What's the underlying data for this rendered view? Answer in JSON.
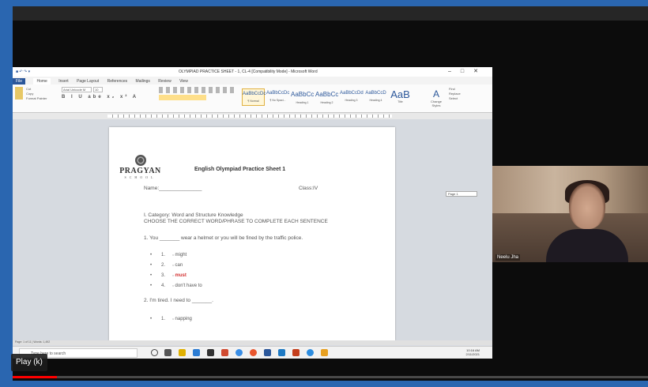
{
  "player": {
    "tooltip": "Play (k)",
    "progress_fraction": 0.07,
    "colors": {
      "progress": "#ff0000",
      "frame": "#2a66b0"
    }
  },
  "word": {
    "title": "OLYMPIAD PRACTICE SHEET - 1, CL-4 [Compatibility Mode] - Microsoft Word",
    "menu": [
      "File",
      "Home",
      "Insert",
      "Page Layout",
      "References",
      "Mailings",
      "Review",
      "View"
    ],
    "ribbon": {
      "font_name": "Arial Unicode M",
      "font_size": "10",
      "styles": [
        {
          "sample": "AaBbCcDc",
          "name": "¶ Normal"
        },
        {
          "sample": "AaBbCcDc",
          "name": "¶ No Spaci..."
        },
        {
          "sample": "AaBbCc",
          "name": "Heading 1"
        },
        {
          "sample": "AaBbCc",
          "name": "Heading 2"
        },
        {
          "sample": "AaBbCcDd",
          "name": "Heading 3"
        },
        {
          "sample": "AaBbCcD",
          "name": "Heading 4"
        },
        {
          "sample": "AaB",
          "name": "Title"
        }
      ],
      "change_styles": "Change Styles",
      "editing": [
        "Find",
        "Replace",
        "Select"
      ],
      "clipboard": [
        "Cut",
        "Copy",
        "Format Painter"
      ]
    },
    "page_label": "Page 1",
    "status_text": "Page: 1 of 11 | Words: 1,492"
  },
  "doc": {
    "logo_name": "PRAGYAN",
    "logo_sub": "SCHOOL",
    "title": "English Olympiad Practice Sheet 1",
    "name_label": "Name:_______________",
    "class_label": "Class:IV",
    "category": "I. Category: Word and Structure Knowledge",
    "instruction": "CHOOSE THE CORRECT WORD/PHRASE TO COMPLETE EACH SENTENCE",
    "q1": "1. You _______ wear a helmet or you will be fined by the traffic police.",
    "q1_options": [
      {
        "num": "1.",
        "text": "might",
        "correct": false
      },
      {
        "num": "2.",
        "text": "can",
        "correct": false
      },
      {
        "num": "3.",
        "text": "must",
        "correct": true
      },
      {
        "num": "4.",
        "text": "don't have to",
        "correct": false
      }
    ],
    "q2": "2. I'm tired. I need to _______.",
    "q2_options": [
      {
        "num": "1.",
        "text": "napping"
      }
    ]
  },
  "taskbar": {
    "search_placeholder": "Type here to search",
    "time": "10:16 AM",
    "date": "2/11/2021"
  },
  "participant": {
    "name": "Neelu Jha"
  }
}
